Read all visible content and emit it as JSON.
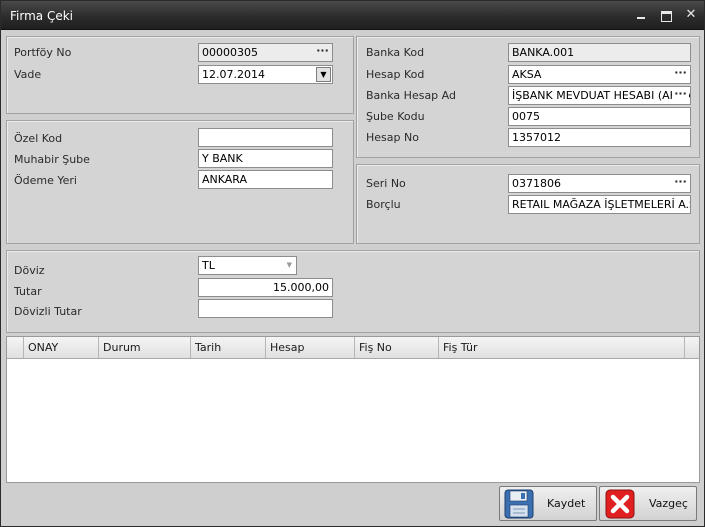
{
  "window": {
    "title": "Firma Çeki"
  },
  "portfoy": {
    "label": "Portföy No",
    "value": "00000305"
  },
  "vade": {
    "label": "Vade",
    "value": "12.07.2014"
  },
  "ozel_kod": {
    "label": "Özel Kod",
    "value": ""
  },
  "muhabir_sube": {
    "label": "Muhabir Şube",
    "value": "Y BANK"
  },
  "odeme_yeri": {
    "label": "Ödeme Yeri",
    "value": "ANKARA"
  },
  "banka_kod": {
    "label": "Banka Kod",
    "value": "BANKA.001"
  },
  "hesap_kod": {
    "label": "Hesap Kod",
    "value": "AKSA"
  },
  "banka_hesap_ad": {
    "label": "Banka Hesap Ad",
    "value": "İŞBANK MEVDUAT HESABI (AKSA"
  },
  "sube_kodu": {
    "label": "Şube Kodu",
    "value": "0075"
  },
  "hesap_no": {
    "label": "Hesap No",
    "value": "1357012"
  },
  "seri_no": {
    "label": "Seri No",
    "value": "0371806"
  },
  "borclu": {
    "label": "Borçlu",
    "value": "RETAIL MAĞAZA İŞLETMELERİ A.Ş."
  },
  "doviz": {
    "label": "Döviz",
    "value": "TL"
  },
  "tutar": {
    "label": "Tutar",
    "value": "15.000,00"
  },
  "dovizli_tutar": {
    "label": "Dövizli Tutar",
    "value": ""
  },
  "grid": {
    "columns": [
      "ONAY",
      "Durum",
      "Tarih",
      "Hesap",
      "Fiş No",
      "Fiş Tür"
    ]
  },
  "buttons": {
    "save": "Kaydet",
    "cancel": "Vazgeç"
  },
  "icons": {
    "window": [
      "minimize-icon",
      "maximize-icon",
      "close-icon"
    ],
    "lookup": "ellipsis-icon",
    "dropdown": "chevron-down-icon",
    "save": "floppy-disk-icon",
    "cancel": "red-x-icon"
  },
  "colors": {
    "titlebar": "#2c2c2c",
    "panel": "#d4d4d4",
    "field": "#ffffff",
    "cancel_icon": "#e02020",
    "save_icon": "#3a6fb0"
  }
}
